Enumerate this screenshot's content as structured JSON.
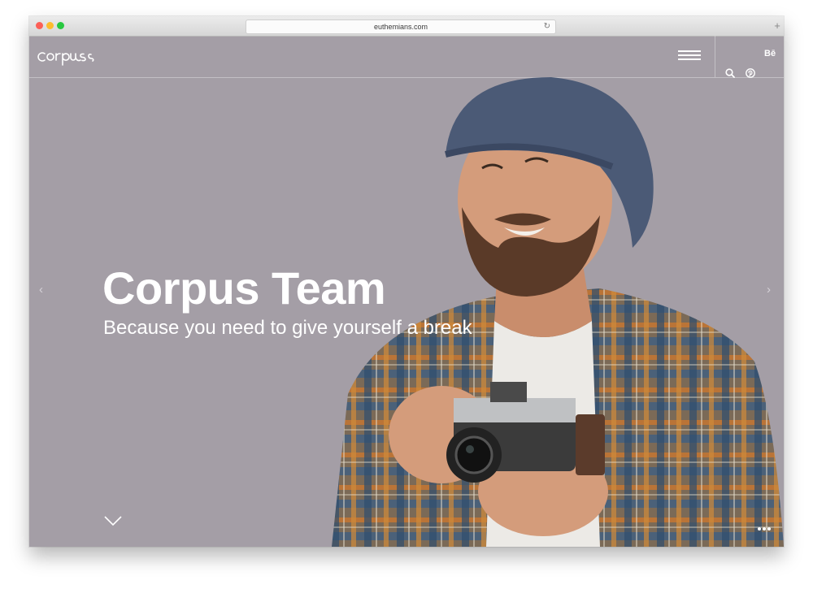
{
  "browser": {
    "url": "euthemians.com",
    "reload_glyph": "↻",
    "new_tab_glyph": "+"
  },
  "site": {
    "logo_text": "corpus",
    "brand_logo_icon": "behance-icon",
    "behance_label": "Bē"
  },
  "hero": {
    "title": "Corpus Team",
    "subtitle": "Because you need to give yourself a break",
    "prev_glyph": "‹",
    "next_glyph": "›"
  },
  "colors": {
    "background": "#a49ea6",
    "text": "#ffffff",
    "chrome": "#dcdcdc"
  }
}
